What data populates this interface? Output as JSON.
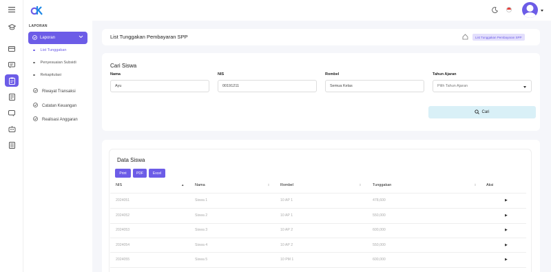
{
  "sidebar": {
    "section": "LAPORAN",
    "active_menu": "Laporan",
    "submenu": [
      "List Tunggakan",
      "Penyesuaian Subsidi",
      "Rekapitulasi"
    ],
    "menus": [
      "Riwayat Transaksi",
      "Catatan Keuangan",
      "Realisasi Anggaran"
    ]
  },
  "header": {
    "title": "List Tunggakan Pembayaran SPP",
    "breadcrumb": "List Tunggakan Pembayaran SPP"
  },
  "search": {
    "title": "Cari Siswa",
    "nama_label": "Nama",
    "nama_value": "Ayu",
    "nis_label": "NIS",
    "nis_value": "00191211",
    "rombel_label": "Rombel",
    "rombel_value": "Semua Kelas",
    "tahun_label": "Tahun Ajaran",
    "tahun_placeholder": "Pilih Tahun Ajaran",
    "button": "Cari"
  },
  "table": {
    "title": "Data Siswa",
    "buttons": [
      "Print",
      "PDF",
      "Excel"
    ],
    "headers": [
      "NIS",
      "Nama",
      "Rombel",
      "Tunggakan",
      "Aksi"
    ],
    "rows": [
      [
        "2024051",
        "Siswa 1",
        "10 AP 1",
        "478,600"
      ],
      [
        "2024052",
        "Siswa 2",
        "10 AP 1",
        "550,000"
      ],
      [
        "2024053",
        "Siswa 3",
        "10 AP 2",
        "600,000"
      ],
      [
        "2024054",
        "Siswa 4",
        "10 AP 2",
        "550,000"
      ],
      [
        "2024055",
        "Siswa 5",
        "10 PM 1",
        "600,000"
      ]
    ]
  },
  "colors": {
    "accent": "#6c5ce7",
    "cari_button": "#d9f0f7"
  }
}
